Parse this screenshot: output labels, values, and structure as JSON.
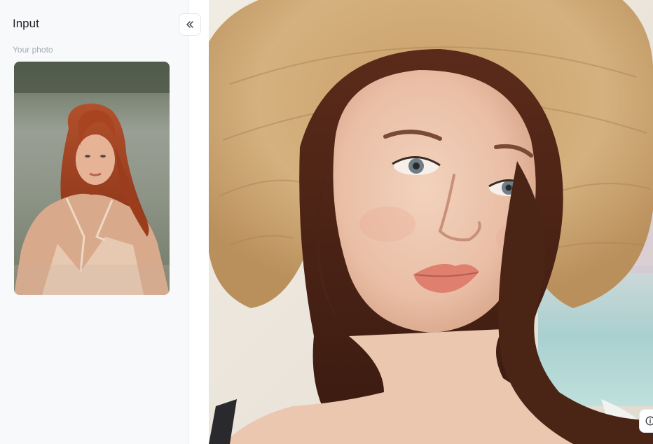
{
  "sidebar": {
    "title": "Input",
    "photo_section_label": "Your photo"
  },
  "icons": {
    "collapse": "double-chevron-left-icon",
    "info": "info-icon"
  },
  "colors": {
    "sidebar_bg": "#f8f9fb",
    "title_text": "#1f2329",
    "label_text": "#a5abb5",
    "border": "#e4e6eb"
  }
}
